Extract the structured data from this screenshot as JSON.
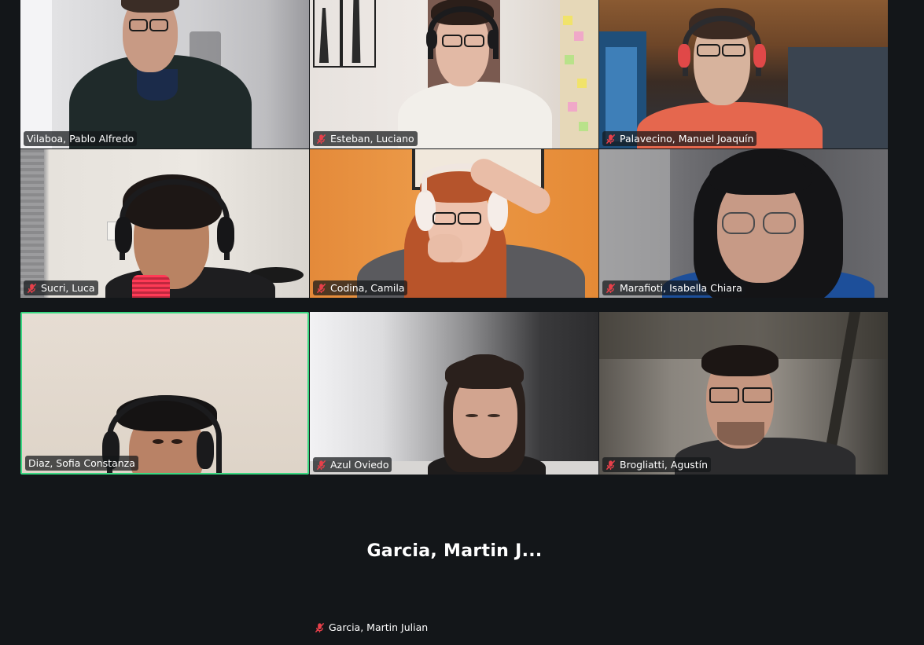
{
  "participants": [
    {
      "name": "Vilaboa, Pablo Alfredo",
      "muted": false,
      "active": false
    },
    {
      "name": "Esteban, Luciano",
      "muted": true,
      "active": false
    },
    {
      "name": "Palavecino, Manuel Joaquín",
      "muted": true,
      "active": false
    },
    {
      "name": "Sucri, Luca",
      "muted": true,
      "active": false
    },
    {
      "name": "Codina, Camila",
      "muted": true,
      "active": false
    },
    {
      "name": "Marafioti, Isabella Chiara",
      "muted": true,
      "active": false
    },
    {
      "name": "Diaz, Sofia Constanza",
      "muted": false,
      "active": true
    },
    {
      "name": "Azul Oviedo",
      "muted": true,
      "active": false
    },
    {
      "name": "Brogliatti, Agustín",
      "muted": true,
      "active": false
    }
  ],
  "no_video_participant": {
    "display_name": "Garcia, Martin J...",
    "name": "Garcia, Martin Julian",
    "muted": true
  },
  "colors": {
    "background": "#131619",
    "active_border": "#39d882",
    "muted_icon": "#e8404a"
  }
}
